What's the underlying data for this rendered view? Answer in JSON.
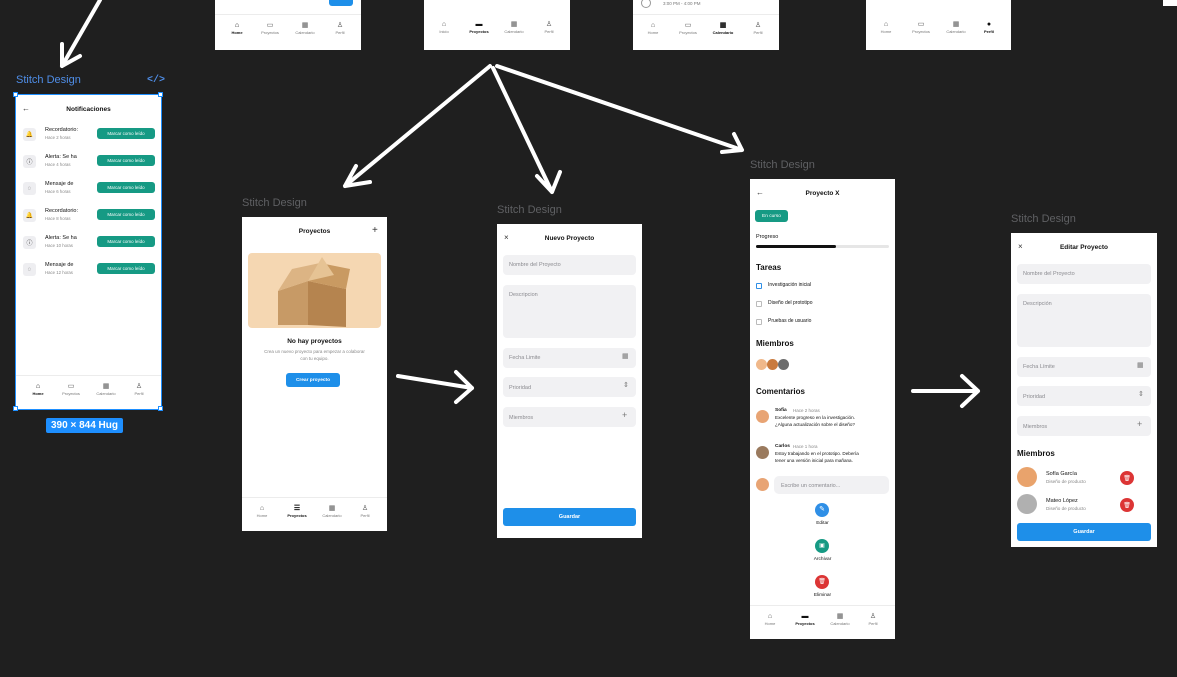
{
  "canvas": {
    "frame_label": "Stitch Design",
    "size_badge": "390 × 844 Hug",
    "code_icon": "</>"
  },
  "nav": {
    "home": "Home",
    "inicio": "Inicio",
    "proyectos": "Proyectos",
    "calendario": "Calendario",
    "perfil": "Perfil"
  },
  "top_partial": {
    "time_text": "3:00 PM - 4:00 PM"
  },
  "notifications": {
    "title": "Notificaciones",
    "mark_read": "Marcar como leído",
    "items": [
      {
        "title": "Recordatorio:",
        "time": "Hace 2 horas",
        "icon": "bell-icon"
      },
      {
        "title": "Alerta: Se ha",
        "time": "Hace 4 horas",
        "icon": "alert-icon"
      },
      {
        "title": "Mensaje de",
        "time": "Hace 6 horas",
        "icon": "message-icon"
      },
      {
        "title": "Recordatorio:",
        "time": "Hace 8 horas",
        "icon": "bell-icon"
      },
      {
        "title": "Alerta: Se ha",
        "time": "Hace 10 horas",
        "icon": "alert-icon"
      },
      {
        "title": "Mensaje de",
        "time": "Hace 12 horas",
        "icon": "message-icon"
      }
    ]
  },
  "projects_empty": {
    "title": "Proyectos",
    "empty_title": "No hay proyectos",
    "empty_desc_1": "Crea un nuevo proyecto para empezar a colaborar",
    "empty_desc_2": "con tu equipo.",
    "create_button": "Crear proyecto"
  },
  "new_project": {
    "title": "Nuevo Proyecto",
    "name_placeholder": "Nombre del Proyecto",
    "desc_placeholder": "Descripcion",
    "date_placeholder": "Fecha Limite",
    "priority_placeholder": "Prioridad",
    "members_placeholder": "Miembros",
    "save_button": "Guardar"
  },
  "project_x": {
    "title": "Proyecto X",
    "status": "En curso",
    "progress_label": "Progreso",
    "progress": 0.6,
    "tasks_title": "Tareas",
    "tasks": [
      "Investigación inicial",
      "Diseño del prototipo",
      "Pruebas de usuario"
    ],
    "members_title": "Miembros",
    "comments_title": "Comentarios",
    "comments": [
      {
        "author": "Sofia",
        "time": "Hace 2 horas",
        "line1": "Excelente progreso en la investigación.",
        "line2": "¿Alguna actualización sobre el diseño?"
      },
      {
        "author": "Carlos",
        "time": "Hace 1 hora",
        "line1": "Estoy trabajando en el prototipo. Debería",
        "line2": "tener una versión inicial para mañana."
      }
    ],
    "comment_placeholder": "Escribe un comentario...",
    "edit": "Editar",
    "archive": "Archivar",
    "delete": "Eliminar"
  },
  "edit_project": {
    "title": "Editar Proyecto",
    "name_placeholder": "Nombre del Proyecto",
    "desc_placeholder": "Descripción",
    "date_placeholder": "Fecha Límite",
    "priority_placeholder": "Prioridad",
    "members_placeholder": "Miembros",
    "members_title": "Miembros",
    "members": [
      {
        "name": "Sofía García",
        "role": "Diseño de producto"
      },
      {
        "name": "Mateo López",
        "role": "Diseño de producto"
      }
    ],
    "save_button": "Guardar"
  },
  "colors": {
    "canvas_bg": "#1f1f1f",
    "primary": "#1e8fe9",
    "success": "#169a84",
    "danger": "#dc3535",
    "selection": "#1e8fff"
  }
}
